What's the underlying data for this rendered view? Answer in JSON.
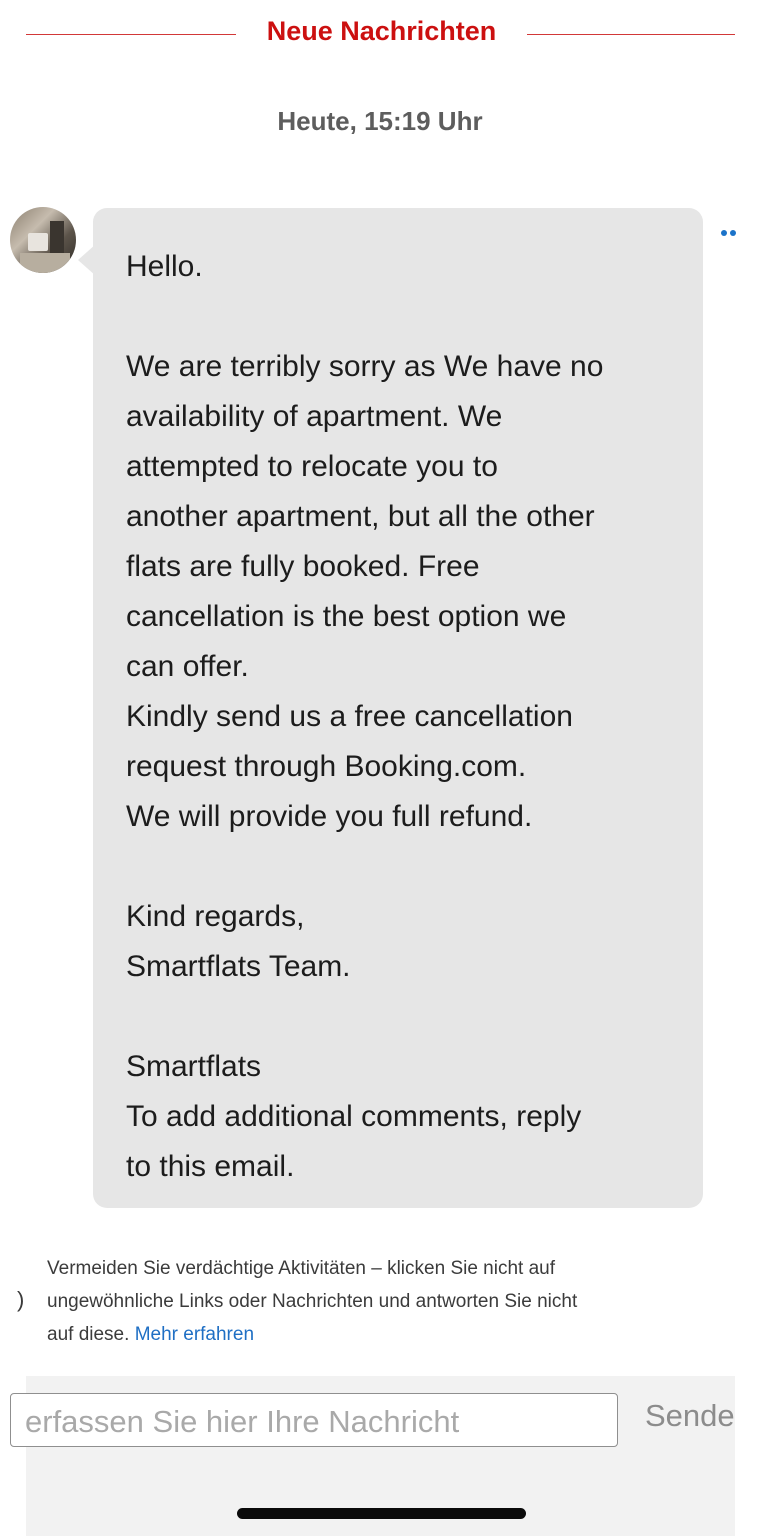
{
  "divider": {
    "label": "Neue Nachrichten"
  },
  "timestamp": "Heute, 15:19 Uhr",
  "message": {
    "greeting": "Hello.",
    "p1_lines": [
      "We are terribly sorry as We have no",
      "availability of apartment. We",
      "attempted to relocate you to",
      "another apartment, but all the other",
      "flats are fully booked. Free",
      "cancellation is the best option we",
      "can offer.",
      "Kindly send us a free cancellation",
      "request through Booking.com.",
      "We will provide you full refund."
    ],
    "regards_lines": [
      "Kind regards,",
      "Smartflats Team."
    ],
    "footer_lines": [
      "Smartflats",
      "To add additional comments, reply",
      "to this email."
    ]
  },
  "notice": {
    "line1": "Vermeiden Sie verdächtige Aktivitäten – klicken Sie nicht auf",
    "line2": "ungewöhnliche Links oder Nachrichten und antworten Sie nicht",
    "line3": "auf diese.",
    "link": "Mehr erfahren"
  },
  "composer": {
    "placeholder": "erfassen Sie hier Ihre Nachricht",
    "send_label": "Sende"
  },
  "colors": {
    "accent_red": "#cc1010",
    "link_blue": "#1f6fc4",
    "bubble_bg": "#e6e6e6"
  }
}
